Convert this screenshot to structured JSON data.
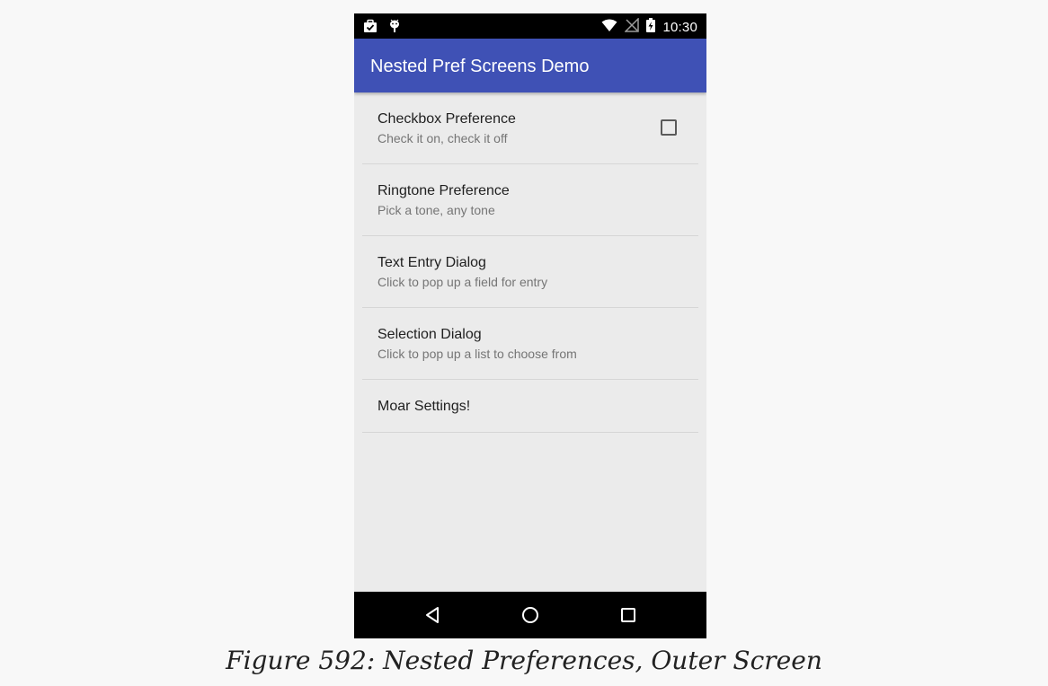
{
  "status_bar": {
    "time": "10:30",
    "left_icons": [
      "briefcase-check-icon",
      "android-icon"
    ],
    "right_icons": [
      "wifi-icon",
      "no-signal-icon",
      "battery-charging-icon"
    ]
  },
  "app_bar": {
    "title": "Nested Pref Screens Demo",
    "color": "#3f51b5"
  },
  "preferences": [
    {
      "title": "Checkbox Preference",
      "summary": "Check it on, check it off",
      "checked": false
    },
    {
      "title": "Ringtone Preference",
      "summary": "Pick a tone, any tone"
    },
    {
      "title": "Text Entry Dialog",
      "summary": "Click to pop up a field for entry"
    },
    {
      "title": "Selection Dialog",
      "summary": "Click to pop up a list to choose from"
    },
    {
      "title": "Moar Settings!"
    }
  ],
  "nav_bar": {
    "buttons": [
      "back-icon",
      "home-icon",
      "recents-icon"
    ]
  },
  "caption": "Figure 592: Nested Preferences, Outer Screen"
}
